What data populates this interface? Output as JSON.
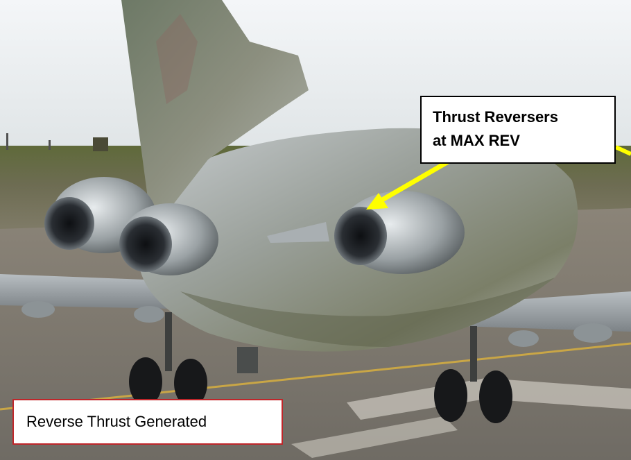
{
  "callout": {
    "line1": "Thrust Reversers",
    "line2": "at MAX REV",
    "arrow_color": "#ffff00"
  },
  "caption": {
    "text": "Reverse Thrust Generated",
    "border_color": "#c0262a"
  }
}
